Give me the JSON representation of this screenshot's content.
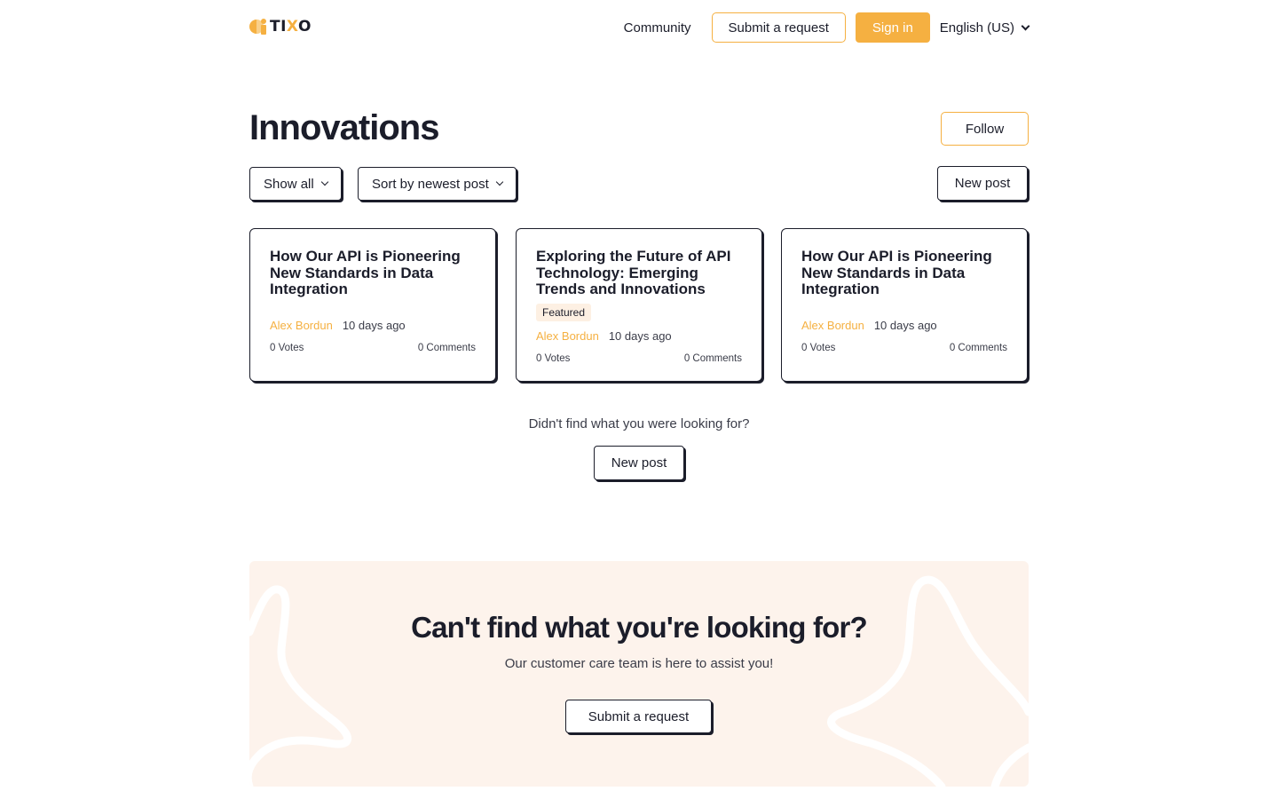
{
  "header": {
    "logo_text_pre": "TI",
    "logo_text_x": "X",
    "logo_text_post": "O",
    "nav_community": "Community",
    "submit_request": "Submit a request",
    "sign_in": "Sign in",
    "language": "English (US)"
  },
  "page": {
    "title": "Innovations",
    "follow": "Follow",
    "filter_show": "Show all",
    "filter_sort": "Sort by newest post",
    "new_post": "New post"
  },
  "posts": [
    {
      "title": "How Our API is Pioneering New Standards in Data Integration",
      "badge": "",
      "author": "Alex Bordun",
      "time": "10 days ago",
      "votes": "0  Votes",
      "comments": "0  Comments"
    },
    {
      "title": "Exploring the Future of API Technology: Emerging Trends and Innovations",
      "badge": "Featured",
      "author": "Alex Bordun",
      "time": "10 days ago",
      "votes": "0  Votes",
      "comments": "0  Comments"
    },
    {
      "title": "How Our API is Pioneering New Standards in Data Integration",
      "badge": "",
      "author": "Alex Bordun",
      "time": "10 days ago",
      "votes": "0  Votes",
      "comments": "0  Comments"
    }
  ],
  "prompt": {
    "text": "Didn't find what you were looking for?",
    "button": "New post"
  },
  "banner": {
    "title": "Can't find what you're looking for?",
    "subtitle": "Our customer care team is here to assist you!",
    "button": "Submit a request"
  },
  "colors": {
    "accent": "#f5b041",
    "text": "#1b1d2a",
    "banner_bg": "#fdf3ec"
  }
}
